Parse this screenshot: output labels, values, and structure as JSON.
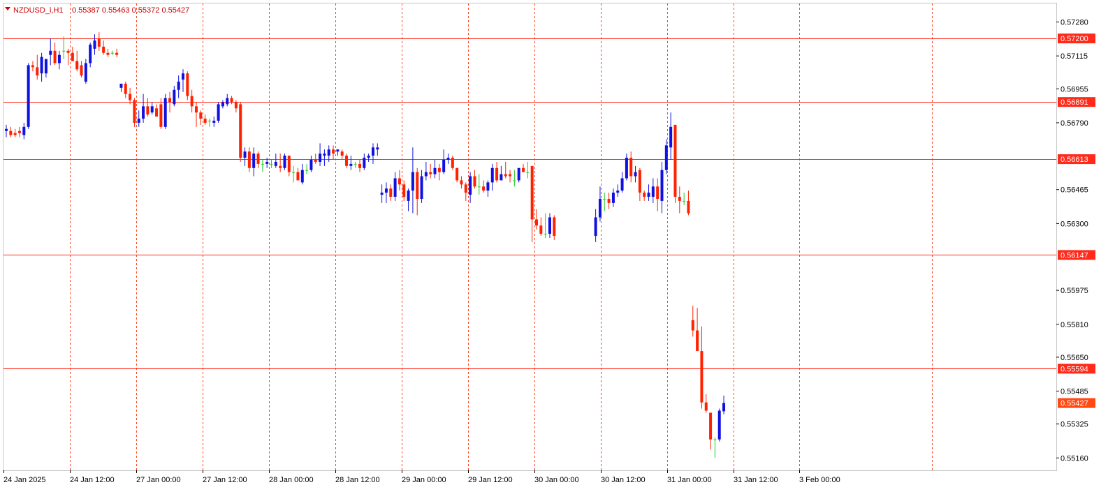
{
  "header": {
    "symbol": "NZDUSD_i,H1",
    "ohlc": "0.55387 0.55463 0.55372 0.55427"
  },
  "colors": {
    "bull": "#1010e0",
    "bear": "#ff2200",
    "doji": "#22cc22",
    "grid": "#ff4422",
    "level_line": "#ff2a1a",
    "level_badge": "#ff2a1a",
    "price_badge": "#ff4a14",
    "frame": "#d0d0d0"
  },
  "chart_data": {
    "type": "candlestick",
    "symbol": "NZDUSD_i",
    "timeframe": "H1",
    "ylim": [
      0.551,
      0.5737
    ],
    "y_ticks": [
      "0.57280",
      "0.57115",
      "0.56955",
      "0.56790",
      "0.56465",
      "0.56300",
      "0.55975",
      "0.55810",
      "0.55650",
      "0.55485",
      "0.55325",
      "0.55160"
    ],
    "x_ticks": [
      "24 Jan 2025",
      "24 Jan 12:00",
      "27 Jan 00:00",
      "27 Jan 12:00",
      "28 Jan 00:00",
      "28 Jan 12:00",
      "29 Jan 00:00",
      "29 Jan 12:00",
      "30 Jan 00:00",
      "30 Jan 12:00",
      "31 Jan 00:00",
      "31 Jan 12:00",
      "3 Feb 00:00"
    ],
    "grid": "vertical-dashed",
    "levels": [
      "0.57200",
      "0.56891",
      "0.56613",
      "0.56147",
      "0.55594"
    ],
    "current_price": "0.55427",
    "candles": [
      {
        "o": 0.5675,
        "h": 0.5678,
        "l": 0.5672,
        "c": 0.5676
      },
      {
        "o": 0.5675,
        "h": 0.5677,
        "l": 0.5672,
        "c": 0.5673
      },
      {
        "o": 0.5674,
        "h": 0.5676,
        "l": 0.5672,
        "c": 0.5673
      },
      {
        "o": 0.5675,
        "h": 0.5677,
        "l": 0.5672,
        "c": 0.5674
      },
      {
        "o": 0.5673,
        "h": 0.5679,
        "l": 0.5671,
        "c": 0.5677
      },
      {
        "o": 0.5677,
        "h": 0.5708,
        "l": 0.5676,
        "c": 0.5707
      },
      {
        "o": 0.5707,
        "h": 0.5709,
        "l": 0.5704,
        "c": 0.5706
      },
      {
        "o": 0.5706,
        "h": 0.5712,
        "l": 0.57,
        "c": 0.5702
      },
      {
        "o": 0.5703,
        "h": 0.5713,
        "l": 0.5699,
        "c": 0.5711
      },
      {
        "o": 0.5703,
        "h": 0.571,
        "l": 0.5701,
        "c": 0.571
      },
      {
        "o": 0.5712,
        "h": 0.572,
        "l": 0.5707,
        "c": 0.5714
      },
      {
        "o": 0.5714,
        "h": 0.5718,
        "l": 0.5707,
        "c": 0.5708
      },
      {
        "o": 0.5708,
        "h": 0.5714,
        "l": 0.5705,
        "c": 0.5712
      },
      {
        "o": 0.5714,
        "h": 0.5721,
        "l": 0.571,
        "c": 0.5714
      },
      {
        "o": 0.5714,
        "h": 0.5715,
        "l": 0.5707,
        "c": 0.5713
      },
      {
        "o": 0.5713,
        "h": 0.5716,
        "l": 0.5709,
        "c": 0.5709
      },
      {
        "o": 0.5709,
        "h": 0.5714,
        "l": 0.5704,
        "c": 0.5705
      },
      {
        "o": 0.5707,
        "h": 0.5709,
        "l": 0.5701,
        "c": 0.5702
      },
      {
        "o": 0.5699,
        "h": 0.571,
        "l": 0.5698,
        "c": 0.5708
      },
      {
        "o": 0.5708,
        "h": 0.5718,
        "l": 0.5706,
        "c": 0.5717
      },
      {
        "o": 0.5715,
        "h": 0.5722,
        "l": 0.5712,
        "c": 0.5719
      },
      {
        "o": 0.572,
        "h": 0.5723,
        "l": 0.5714,
        "c": 0.5716
      },
      {
        "o": 0.5716,
        "h": 0.5719,
        "l": 0.5712,
        "c": 0.5713
      },
      {
        "o": 0.5713,
        "h": 0.5715,
        "l": 0.5711,
        "c": 0.5712
      },
      {
        "o": 0.5713,
        "h": 0.5714,
        "l": 0.5712,
        "c": 0.5713
      },
      {
        "o": 0.5713,
        "h": 0.5715,
        "l": 0.5711,
        "c": 0.5712
      },
      {
        "o": 0.5696,
        "h": 0.5698,
        "l": 0.5694,
        "c": 0.5698
      },
      {
        "o": 0.5698,
        "h": 0.5699,
        "l": 0.5691,
        "c": 0.5693
      },
      {
        "o": 0.5693,
        "h": 0.5696,
        "l": 0.5688,
        "c": 0.569
      },
      {
        "o": 0.569,
        "h": 0.5691,
        "l": 0.5677,
        "c": 0.5679
      },
      {
        "o": 0.5679,
        "h": 0.5685,
        "l": 0.5677,
        "c": 0.5681
      },
      {
        "o": 0.5681,
        "h": 0.5693,
        "l": 0.5679,
        "c": 0.5687
      },
      {
        "o": 0.5687,
        "h": 0.5691,
        "l": 0.5682,
        "c": 0.5683
      },
      {
        "o": 0.5684,
        "h": 0.5689,
        "l": 0.5683,
        "c": 0.5687
      },
      {
        "o": 0.5686,
        "h": 0.5688,
        "l": 0.5683,
        "c": 0.5682
      },
      {
        "o": 0.5688,
        "h": 0.5691,
        "l": 0.5676,
        "c": 0.5677
      },
      {
        "o": 0.5677,
        "h": 0.5693,
        "l": 0.5676,
        "c": 0.5691
      },
      {
        "o": 0.5691,
        "h": 0.5694,
        "l": 0.5684,
        "c": 0.5689
      },
      {
        "o": 0.5688,
        "h": 0.5697,
        "l": 0.5687,
        "c": 0.5695
      },
      {
        "o": 0.5695,
        "h": 0.5702,
        "l": 0.5691,
        "c": 0.5699
      },
      {
        "o": 0.57,
        "h": 0.5705,
        "l": 0.5694,
        "c": 0.5703
      },
      {
        "o": 0.5703,
        "h": 0.5704,
        "l": 0.569,
        "c": 0.5692
      },
      {
        "o": 0.5692,
        "h": 0.5695,
        "l": 0.5684,
        "c": 0.5687
      },
      {
        "o": 0.5687,
        "h": 0.5689,
        "l": 0.5677,
        "c": 0.5684
      },
      {
        "o": 0.5684,
        "h": 0.5685,
        "l": 0.5678,
        "c": 0.5681
      },
      {
        "o": 0.5681,
        "h": 0.5683,
        "l": 0.5678,
        "c": 0.5679
      },
      {
        "o": 0.568,
        "h": 0.5681,
        "l": 0.5677,
        "c": 0.568
      },
      {
        "o": 0.5679,
        "h": 0.5682,
        "l": 0.5677,
        "c": 0.568
      },
      {
        "o": 0.568,
        "h": 0.5689,
        "l": 0.5679,
        "c": 0.5688
      },
      {
        "o": 0.5687,
        "h": 0.569,
        "l": 0.5686,
        "c": 0.5689
      },
      {
        "o": 0.5688,
        "h": 0.5693,
        "l": 0.5687,
        "c": 0.5691
      },
      {
        "o": 0.5691,
        "h": 0.5692,
        "l": 0.5688,
        "c": 0.5689
      },
      {
        "o": 0.5689,
        "h": 0.569,
        "l": 0.5684,
        "c": 0.5686
      },
      {
        "o": 0.5688,
        "h": 0.5689,
        "l": 0.566,
        "c": 0.5662
      },
      {
        "o": 0.5662,
        "h": 0.5667,
        "l": 0.5658,
        "c": 0.5665
      },
      {
        "o": 0.5665,
        "h": 0.5667,
        "l": 0.5655,
        "c": 0.5657
      },
      {
        "o": 0.5657,
        "h": 0.5667,
        "l": 0.5653,
        "c": 0.5664
      },
      {
        "o": 0.5664,
        "h": 0.5665,
        "l": 0.5657,
        "c": 0.5659
      },
      {
        "o": 0.5659,
        "h": 0.5661,
        "l": 0.5655,
        "c": 0.5659
      },
      {
        "o": 0.5659,
        "h": 0.5662,
        "l": 0.5657,
        "c": 0.566
      },
      {
        "o": 0.5659,
        "h": 0.5661,
        "l": 0.5657,
        "c": 0.5659
      },
      {
        "o": 0.5658,
        "h": 0.5664,
        "l": 0.5657,
        "c": 0.566
      },
      {
        "o": 0.5658,
        "h": 0.5664,
        "l": 0.5655,
        "c": 0.5657
      },
      {
        "o": 0.5657,
        "h": 0.5664,
        "l": 0.5656,
        "c": 0.5663
      },
      {
        "o": 0.5663,
        "h": 0.5663,
        "l": 0.5653,
        "c": 0.5655
      },
      {
        "o": 0.5655,
        "h": 0.5658,
        "l": 0.565,
        "c": 0.5655
      },
      {
        "o": 0.5655,
        "h": 0.5657,
        "l": 0.5651,
        "c": 0.5651
      },
      {
        "o": 0.565,
        "h": 0.5659,
        "l": 0.5649,
        "c": 0.5656
      },
      {
        "o": 0.5656,
        "h": 0.5659,
        "l": 0.5654,
        "c": 0.5656
      },
      {
        "o": 0.5656,
        "h": 0.5663,
        "l": 0.5655,
        "c": 0.5661
      },
      {
        "o": 0.5661,
        "h": 0.5664,
        "l": 0.5659,
        "c": 0.566
      },
      {
        "o": 0.566,
        "h": 0.5669,
        "l": 0.5658,
        "c": 0.5664
      },
      {
        "o": 0.5663,
        "h": 0.5666,
        "l": 0.5658,
        "c": 0.5664
      },
      {
        "o": 0.5663,
        "h": 0.5668,
        "l": 0.566,
        "c": 0.5666
      },
      {
        "o": 0.5666,
        "h": 0.5668,
        "l": 0.5661,
        "c": 0.5664
      },
      {
        "o": 0.5665,
        "h": 0.5666,
        "l": 0.5663,
        "c": 0.5666
      },
      {
        "o": 0.5665,
        "h": 0.5666,
        "l": 0.5661,
        "c": 0.5663
      },
      {
        "o": 0.5663,
        "h": 0.5664,
        "l": 0.5657,
        "c": 0.5658
      },
      {
        "o": 0.5658,
        "h": 0.5663,
        "l": 0.5656,
        "c": 0.5659
      },
      {
        "o": 0.5659,
        "h": 0.566,
        "l": 0.5657,
        "c": 0.5659
      },
      {
        "o": 0.5659,
        "h": 0.5661,
        "l": 0.5655,
        "c": 0.5657
      },
      {
        "o": 0.5657,
        "h": 0.5664,
        "l": 0.5656,
        "c": 0.5662
      },
      {
        "o": 0.5662,
        "h": 0.5664,
        "l": 0.566,
        "c": 0.5663
      },
      {
        "o": 0.5663,
        "h": 0.5669,
        "l": 0.5659,
        "c": 0.5667
      },
      {
        "o": 0.5666,
        "h": 0.5669,
        "l": 0.5663,
        "c": 0.5667
      },
      {
        "o": 0.5644,
        "h": 0.5649,
        "l": 0.564,
        "c": 0.5645
      },
      {
        "o": 0.5645,
        "h": 0.565,
        "l": 0.564,
        "c": 0.5647
      },
      {
        "o": 0.5647,
        "h": 0.5649,
        "l": 0.5641,
        "c": 0.5643
      },
      {
        "o": 0.5643,
        "h": 0.5655,
        "l": 0.5641,
        "c": 0.5652
      },
      {
        "o": 0.5652,
        "h": 0.5656,
        "l": 0.5646,
        "c": 0.5649
      },
      {
        "o": 0.5649,
        "h": 0.5651,
        "l": 0.5641,
        "c": 0.5643
      },
      {
        "o": 0.5641,
        "h": 0.5647,
        "l": 0.5636,
        "c": 0.5646
      },
      {
        "o": 0.5646,
        "h": 0.5667,
        "l": 0.5635,
        "c": 0.5655
      },
      {
        "o": 0.5655,
        "h": 0.5657,
        "l": 0.5634,
        "c": 0.5642
      },
      {
        "o": 0.5642,
        "h": 0.5656,
        "l": 0.564,
        "c": 0.5653
      },
      {
        "o": 0.5653,
        "h": 0.566,
        "l": 0.5651,
        "c": 0.5655
      },
      {
        "o": 0.5655,
        "h": 0.5659,
        "l": 0.5652,
        "c": 0.5654
      },
      {
        "o": 0.5654,
        "h": 0.5661,
        "l": 0.5652,
        "c": 0.5657
      },
      {
        "o": 0.5657,
        "h": 0.5659,
        "l": 0.5651,
        "c": 0.5655
      },
      {
        "o": 0.5655,
        "h": 0.5666,
        "l": 0.5654,
        "c": 0.5661
      },
      {
        "o": 0.5661,
        "h": 0.5664,
        "l": 0.5659,
        "c": 0.5662
      },
      {
        "o": 0.5662,
        "h": 0.5663,
        "l": 0.5656,
        "c": 0.5657
      },
      {
        "o": 0.5657,
        "h": 0.5657,
        "l": 0.565,
        "c": 0.5651
      },
      {
        "o": 0.5651,
        "h": 0.5653,
        "l": 0.5647,
        "c": 0.5649
      },
      {
        "o": 0.5649,
        "h": 0.565,
        "l": 0.5641,
        "c": 0.5645
      },
      {
        "o": 0.5644,
        "h": 0.5655,
        "l": 0.564,
        "c": 0.5653
      },
      {
        "o": 0.5653,
        "h": 0.5656,
        "l": 0.5647,
        "c": 0.5648
      },
      {
        "o": 0.5648,
        "h": 0.5654,
        "l": 0.5644,
        "c": 0.5648
      },
      {
        "o": 0.5648,
        "h": 0.5651,
        "l": 0.5645,
        "c": 0.5646
      },
      {
        "o": 0.5646,
        "h": 0.5651,
        "l": 0.5643,
        "c": 0.565
      },
      {
        "o": 0.565,
        "h": 0.5659,
        "l": 0.5646,
        "c": 0.5657
      },
      {
        "o": 0.5657,
        "h": 0.566,
        "l": 0.565,
        "c": 0.5651
      },
      {
        "o": 0.5651,
        "h": 0.5658,
        "l": 0.5651,
        "c": 0.5654
      },
      {
        "o": 0.5654,
        "h": 0.566,
        "l": 0.5652,
        "c": 0.5653
      },
      {
        "o": 0.5654,
        "h": 0.5656,
        "l": 0.565,
        "c": 0.5653
      },
      {
        "o": 0.5651,
        "h": 0.5656,
        "l": 0.5648,
        "c": 0.5651
      },
      {
        "o": 0.5651,
        "h": 0.5657,
        "l": 0.565,
        "c": 0.5657
      },
      {
        "o": 0.5657,
        "h": 0.5659,
        "l": 0.5655,
        "c": 0.5655
      },
      {
        "o": 0.5655,
        "h": 0.566,
        "l": 0.5652,
        "c": 0.5655
      },
      {
        "o": 0.5658,
        "h": 0.5658,
        "l": 0.5621,
        "c": 0.5632
      },
      {
        "o": 0.5632,
        "h": 0.5637,
        "l": 0.5627,
        "c": 0.5629
      },
      {
        "o": 0.5629,
        "h": 0.5633,
        "l": 0.5624,
        "c": 0.5625
      },
      {
        "o": 0.5625,
        "h": 0.5635,
        "l": 0.5623,
        "c": 0.5625
      },
      {
        "o": 0.5625,
        "h": 0.5635,
        "l": 0.5623,
        "c": 0.5633
      },
      {
        "o": 0.5633,
        "h": 0.5634,
        "l": 0.5622,
        "c": 0.5624
      },
      {
        "o": 0.5624,
        "h": 0.5637,
        "l": 0.5621,
        "c": 0.5633
      },
      {
        "o": 0.5633,
        "h": 0.5648,
        "l": 0.5631,
        "c": 0.5642
      },
      {
        "o": 0.5642,
        "h": 0.5645,
        "l": 0.5636,
        "c": 0.5642
      },
      {
        "o": 0.5642,
        "h": 0.5645,
        "l": 0.5637,
        "c": 0.564
      },
      {
        "o": 0.564,
        "h": 0.5647,
        "l": 0.5638,
        "c": 0.5645
      },
      {
        "o": 0.5645,
        "h": 0.5649,
        "l": 0.5643,
        "c": 0.5646
      },
      {
        "o": 0.5646,
        "h": 0.5655,
        "l": 0.5645,
        "c": 0.5652
      },
      {
        "o": 0.5652,
        "h": 0.5664,
        "l": 0.5651,
        "c": 0.5662
      },
      {
        "o": 0.5662,
        "h": 0.5665,
        "l": 0.565,
        "c": 0.5653
      },
      {
        "o": 0.5653,
        "h": 0.5658,
        "l": 0.565,
        "c": 0.5655
      },
      {
        "o": 0.5656,
        "h": 0.5657,
        "l": 0.5641,
        "c": 0.5645
      },
      {
        "o": 0.5645,
        "h": 0.5646,
        "l": 0.5641,
        "c": 0.5643
      },
      {
        "o": 0.5643,
        "h": 0.5649,
        "l": 0.5641,
        "c": 0.5645
      },
      {
        "o": 0.5643,
        "h": 0.5652,
        "l": 0.564,
        "c": 0.5648
      },
      {
        "o": 0.5648,
        "h": 0.5652,
        "l": 0.5636,
        "c": 0.5642
      },
      {
        "o": 0.5641,
        "h": 0.566,
        "l": 0.5635,
        "c": 0.5656
      },
      {
        "o": 0.5656,
        "h": 0.5671,
        "l": 0.5654,
        "c": 0.5668
      },
      {
        "o": 0.5667,
        "h": 0.5684,
        "l": 0.5661,
        "c": 0.5677
      },
      {
        "o": 0.5678,
        "h": 0.5678,
        "l": 0.564,
        "c": 0.5643
      },
      {
        "o": 0.5643,
        "h": 0.5648,
        "l": 0.5635,
        "c": 0.5641
      },
      {
        "o": 0.5641,
        "h": 0.5645,
        "l": 0.5639,
        "c": 0.5641
      },
      {
        "o": 0.5641,
        "h": 0.5646,
        "l": 0.5634,
        "c": 0.5635
      },
      {
        "o": 0.5583,
        "h": 0.559,
        "l": 0.5575,
        "c": 0.5578
      },
      {
        "o": 0.5578,
        "h": 0.5589,
        "l": 0.5568,
        "c": 0.5568
      },
      {
        "o": 0.5568,
        "h": 0.558,
        "l": 0.554,
        "c": 0.5543
      },
      {
        "o": 0.5543,
        "h": 0.5547,
        "l": 0.5538,
        "c": 0.5539
      },
      {
        "o": 0.5538,
        "h": 0.5538,
        "l": 0.552,
        "c": 0.5525
      },
      {
        "o": 0.5525,
        "h": 0.5526,
        "l": 0.5516,
        "c": 0.5525
      },
      {
        "o": 0.5525,
        "h": 0.554,
        "l": 0.5524,
        "c": 0.5539
      },
      {
        "o": 0.55387,
        "h": 0.55463,
        "l": 0.55372,
        "c": 0.55427
      }
    ]
  }
}
